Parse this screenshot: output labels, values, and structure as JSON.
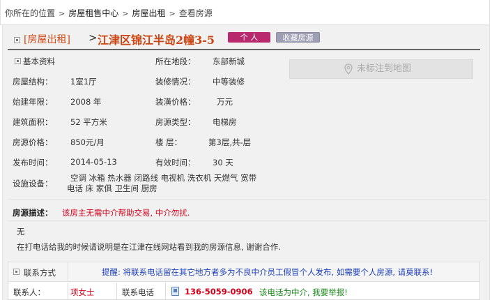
{
  "breadcrumb": {
    "prefix": "你所在的位置",
    "items": [
      "房屋租售中心",
      "房屋出租",
      "查看房源"
    ]
  },
  "title": {
    "category": "[房屋出租]",
    "name": "江津区锦江半岛2幢3-5",
    "badge": "个 人",
    "favorite_label": "收藏房源"
  },
  "basic_info": {
    "section_label": "基本资料",
    "rows": [
      {
        "label": "房屋结构：",
        "value": "1室1厅",
        "label2": "装修情况：",
        "value2": "中等装修"
      },
      {
        "label": "始建年限：",
        "value": "2008 年",
        "label2": "装潢价格：",
        "value2": "万元"
      },
      {
        "label": "建筑面积：",
        "value": "52 平方米",
        "label2": "房源类型：",
        "value2": "电梯房"
      },
      {
        "label": "房源价格：",
        "value": "850元/月",
        "label2": "楼  层：",
        "value2": "第3层,共-层"
      },
      {
        "label": "发布时间：",
        "value": "2014-05-13",
        "label2": "有效时间：",
        "value2": "30 天"
      }
    ],
    "location_label": "所在地段：",
    "location_value": "东部新城",
    "facilities_label": "设施设备：",
    "facilities_line1": "空调 冰箱 热水器 闭路线 电视机 洗衣机 天燃气 宽带",
    "facilities_line2": "电话 床 家俱 卫生间 厨房"
  },
  "map": {
    "label": "未标注到地图",
    "icon": "map-pin-icon"
  },
  "description": {
    "label": "房源描述：",
    "notice": "该房主无需中介帮助交易, 中介勿扰.",
    "body": "无",
    "note": "在打电话给我的时候请说明是在江津在线网站看到我的房源信息, 谢谢合作."
  },
  "contact": {
    "section_label": "联系方式",
    "tip": "提醒: 将联系电话留在其它地方者多为不良中介员工假冒个人发布, 如需要个人房源, 请莫联系!",
    "person_label": "联系人：",
    "person_value": "项女士",
    "phone_label": "联系电话",
    "phone_value": "136-5059-0906",
    "report_text": "该电话为中介, 我要举报!"
  },
  "colors": {
    "accent_red": "#d0021b",
    "title_orange": "#cc4410",
    "badge_purple": "#b8296d",
    "tip_blue": "#1d3fb6",
    "report_green": "#1a8a1a"
  }
}
